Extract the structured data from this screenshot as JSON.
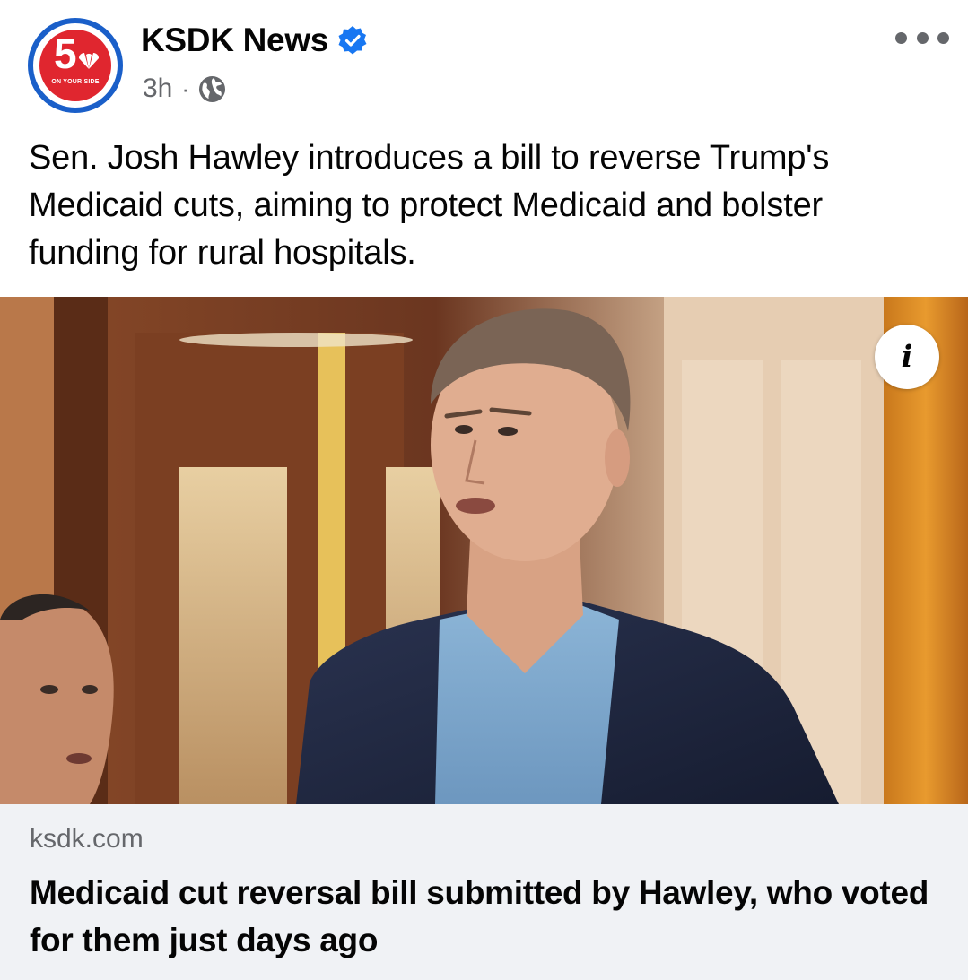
{
  "post": {
    "page_name": "KSDK News",
    "verified": true,
    "timestamp": "3h",
    "separator": "·",
    "privacy_icon": "globe-icon",
    "more_icon": "more-horizontal-icon",
    "caption": "Sen. Josh Hawley introduces a bill to reverse Trump's Medicaid cuts, aiming to protect Medicaid and bolster funding for rural hospitals."
  },
  "avatar": {
    "number": "5",
    "slogan": "ON YOUR SIDE",
    "colors": {
      "ring": "#1a5fc9",
      "core": "#e0262f"
    }
  },
  "media": {
    "info_icon": "info-icon",
    "info_glyph": "i"
  },
  "link": {
    "domain": "ksdk.com",
    "title": "Medicaid cut reversal bill submitted by Hawley, who voted for them just days ago"
  },
  "colors": {
    "text_primary": "#050505",
    "text_secondary": "#65676b",
    "verified_blue": "#1877f2",
    "preview_background": "#f0f2f5"
  }
}
